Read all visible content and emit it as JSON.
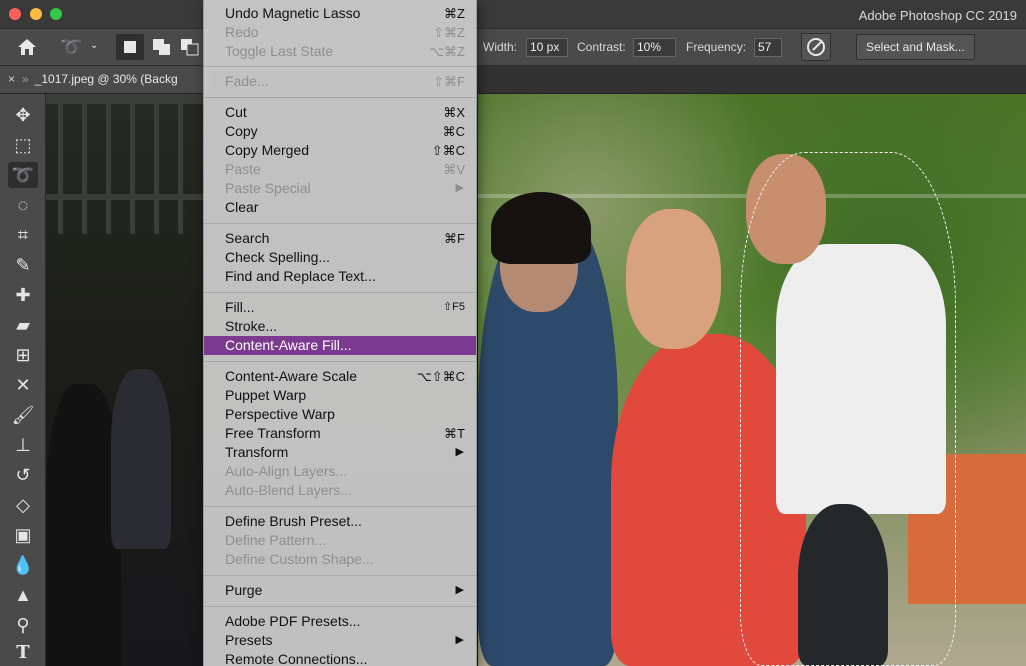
{
  "app": {
    "title": "Adobe Photoshop CC 2019"
  },
  "options_bar": {
    "width_label": "Width:",
    "width_value": "10 px",
    "contrast_label": "Contrast:",
    "contrast_value": "10%",
    "frequency_label": "Frequency:",
    "frequency_value": "57",
    "select_and_mask_label": "Select and Mask...",
    "icons": [
      "home-icon",
      "magnetic-lasso-icon",
      "new-selection-icon",
      "add-selection-icon",
      "subtract-selection-icon",
      "intersect-selection-icon",
      "pen-pressure-icon"
    ]
  },
  "document_tab": {
    "title": "_1017.jpeg @ 30% (Backg"
  },
  "toolbox": {
    "tools": [
      "move-tool",
      "marquee-tool",
      "magnetic-lasso-tool",
      "quick-selection-tool",
      "crop-tool",
      "eyedropper-tool",
      "spot-healing-tool",
      "bandage-tool",
      "frame-tool",
      "content-aware-move-tool",
      "brush-tool",
      "clone-stamp-tool",
      "history-brush-tool",
      "eraser-tool",
      "gradient-tool",
      "blur-tool",
      "sharpen-tool",
      "dodge-tool",
      "type-tool"
    ]
  },
  "edit_menu": {
    "items": [
      {
        "label": "Undo Magnetic Lasso",
        "shortcut": "⌘Z",
        "enabled": true
      },
      {
        "label": "Redo",
        "shortcut": "⇧⌘Z",
        "enabled": false
      },
      {
        "label": "Toggle Last State",
        "shortcut": "⌥⌘Z",
        "enabled": false
      },
      {
        "label": "Fade...",
        "shortcut": "⇧⌘F",
        "enabled": false
      },
      {
        "label": "Cut",
        "shortcut": "⌘X",
        "enabled": true
      },
      {
        "label": "Copy",
        "shortcut": "⌘C",
        "enabled": true
      },
      {
        "label": "Copy Merged",
        "shortcut": "⇧⌘C",
        "enabled": true
      },
      {
        "label": "Paste",
        "shortcut": "⌘V",
        "enabled": false
      },
      {
        "label": "Paste Special",
        "shortcut": "",
        "enabled": false,
        "submenu": true
      },
      {
        "label": "Clear",
        "shortcut": "",
        "enabled": true
      },
      {
        "label": "Search",
        "shortcut": "⌘F",
        "enabled": true
      },
      {
        "label": "Check Spelling...",
        "shortcut": "",
        "enabled": true
      },
      {
        "label": "Find and Replace Text...",
        "shortcut": "",
        "enabled": true
      },
      {
        "label": "Fill...",
        "shortcut": "⇧F5",
        "enabled": true
      },
      {
        "label": "Stroke...",
        "shortcut": "",
        "enabled": true
      },
      {
        "label": "Content-Aware Fill...",
        "shortcut": "",
        "enabled": true,
        "highlighted": true
      },
      {
        "label": "Content-Aware Scale",
        "shortcut": "⌥⇧⌘C",
        "enabled": true
      },
      {
        "label": "Puppet Warp",
        "shortcut": "",
        "enabled": true
      },
      {
        "label": "Perspective Warp",
        "shortcut": "",
        "enabled": true
      },
      {
        "label": "Free Transform",
        "shortcut": "⌘T",
        "enabled": true
      },
      {
        "label": "Transform",
        "shortcut": "",
        "enabled": true,
        "submenu": true
      },
      {
        "label": "Auto-Align Layers...",
        "shortcut": "",
        "enabled": false
      },
      {
        "label": "Auto-Blend Layers...",
        "shortcut": "",
        "enabled": false
      },
      {
        "label": "Define Brush Preset...",
        "shortcut": "",
        "enabled": true
      },
      {
        "label": "Define Pattern...",
        "shortcut": "",
        "enabled": false
      },
      {
        "label": "Define Custom Shape...",
        "shortcut": "",
        "enabled": false
      },
      {
        "label": "Purge",
        "shortcut": "",
        "enabled": true,
        "submenu": true
      },
      {
        "label": "Adobe PDF Presets...",
        "shortcut": "",
        "enabled": true
      },
      {
        "label": "Presets",
        "shortcut": "",
        "enabled": true,
        "submenu": true
      },
      {
        "label": "Remote Connections...",
        "shortcut": "",
        "enabled": true
      }
    ]
  },
  "colors": {
    "menu_highlight": "#7b3a8f",
    "menu_bg": "#cdcdcd",
    "chrome": "#4a4a4a"
  }
}
